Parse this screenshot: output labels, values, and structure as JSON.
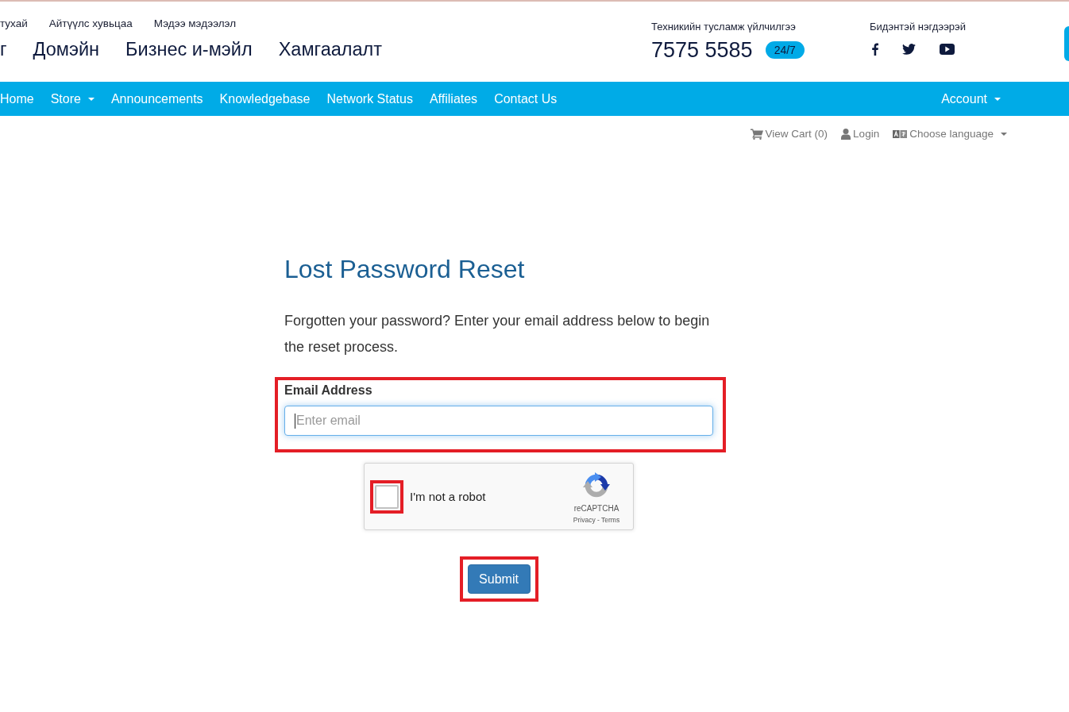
{
  "header": {
    "top_links": [
      "тухай",
      "Айтүүлс хувьцаа",
      "Мэдээ мэдээлэл"
    ],
    "main_links": [
      "г",
      "Домэйн",
      "Бизнес и-мэйл",
      "Хамгаалалт"
    ],
    "support": {
      "label": "Техникийн тусламж үйлчилгээ",
      "phone": "7575 5585",
      "badge": "24/7"
    },
    "social": {
      "label": "Бидэнтэй нэгдээрэй",
      "links": [
        {
          "kind": "facebook"
        },
        {
          "kind": "twitter"
        },
        {
          "kind": "youtube"
        }
      ]
    }
  },
  "nav": {
    "items": [
      {
        "label": "Home",
        "dropdown": false
      },
      {
        "label": "Store",
        "dropdown": true
      },
      {
        "label": "Announcements",
        "dropdown": false
      },
      {
        "label": "Knowledgebase",
        "dropdown": false
      },
      {
        "label": "Network Status",
        "dropdown": false
      },
      {
        "label": "Affiliates",
        "dropdown": false
      },
      {
        "label": "Contact Us",
        "dropdown": false
      }
    ],
    "account": {
      "label": "Account",
      "dropdown": true
    }
  },
  "utility_links": [
    {
      "kind": "cart",
      "label": "View Cart (0)",
      "dropdown": false
    },
    {
      "kind": "user",
      "label": "Login",
      "dropdown": false
    },
    {
      "kind": "language",
      "label": "Choose language",
      "dropdown": true
    }
  ],
  "form": {
    "title": "Lost Password Reset",
    "intro": "Forgotten your password? Enter your email address below to begin the reset process.",
    "email": {
      "label": "Email Address",
      "placeholder": "Enter email",
      "focused": true,
      "highlighted": true
    },
    "captcha": {
      "label": "I'm not a robot",
      "checked": false,
      "highlighted": true,
      "brand": "reCAPTCHA",
      "terms": "Privacy - Terms"
    },
    "submit": {
      "label": "Submit",
      "highlighted": true
    }
  }
}
